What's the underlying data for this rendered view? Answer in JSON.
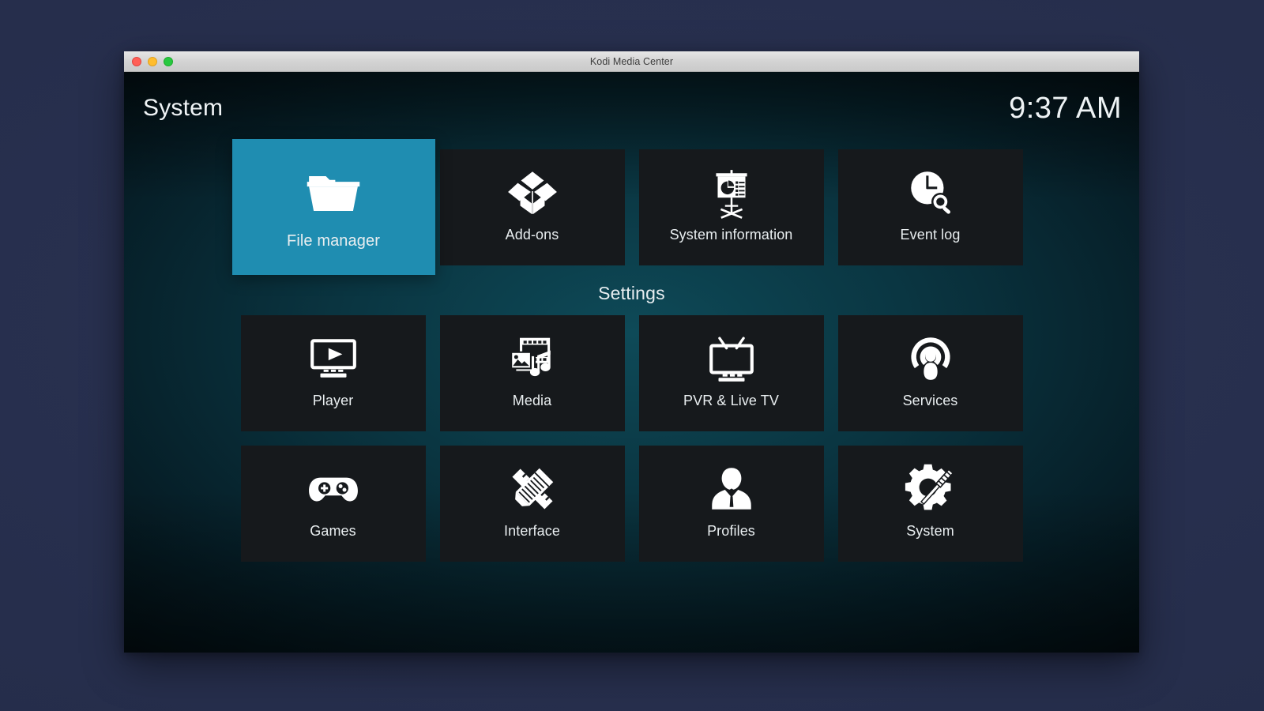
{
  "window": {
    "title": "Kodi Media Center",
    "controls": {
      "close": "close-button",
      "minimize": "minimize-button",
      "maximize": "maximize-button"
    }
  },
  "header": {
    "page_title": "System",
    "clock": "9:37 AM"
  },
  "colors": {
    "accent": "#1f8db1",
    "tile_background": "#16191c",
    "desktop": "#262e4c",
    "text": "#e9eef0"
  },
  "top_row": [
    {
      "label": "File manager",
      "icon": "folder-icon",
      "focused": true
    },
    {
      "label": "Add-ons",
      "icon": "open-box-icon",
      "focused": false
    },
    {
      "label": "System information",
      "icon": "presentation-chart-icon",
      "focused": false
    },
    {
      "label": "Event log",
      "icon": "clock-search-icon",
      "focused": false
    }
  ],
  "settings": {
    "section_title": "Settings",
    "items": [
      {
        "label": "Player",
        "icon": "monitor-play-icon",
        "focused": false
      },
      {
        "label": "Media",
        "icon": "film-photo-music-icon",
        "focused": false
      },
      {
        "label": "PVR & Live TV",
        "icon": "tv-antenna-icon",
        "focused": false
      },
      {
        "label": "Services",
        "icon": "podcast-person-icon",
        "focused": false
      },
      {
        "label": "Games",
        "icon": "gamepad-icon",
        "focused": false
      },
      {
        "label": "Interface",
        "icon": "pencil-ruler-icon",
        "focused": false
      },
      {
        "label": "Profiles",
        "icon": "person-bust-icon",
        "focused": false
      },
      {
        "label": "System",
        "icon": "gear-screwdriver-icon",
        "focused": false
      }
    ]
  }
}
